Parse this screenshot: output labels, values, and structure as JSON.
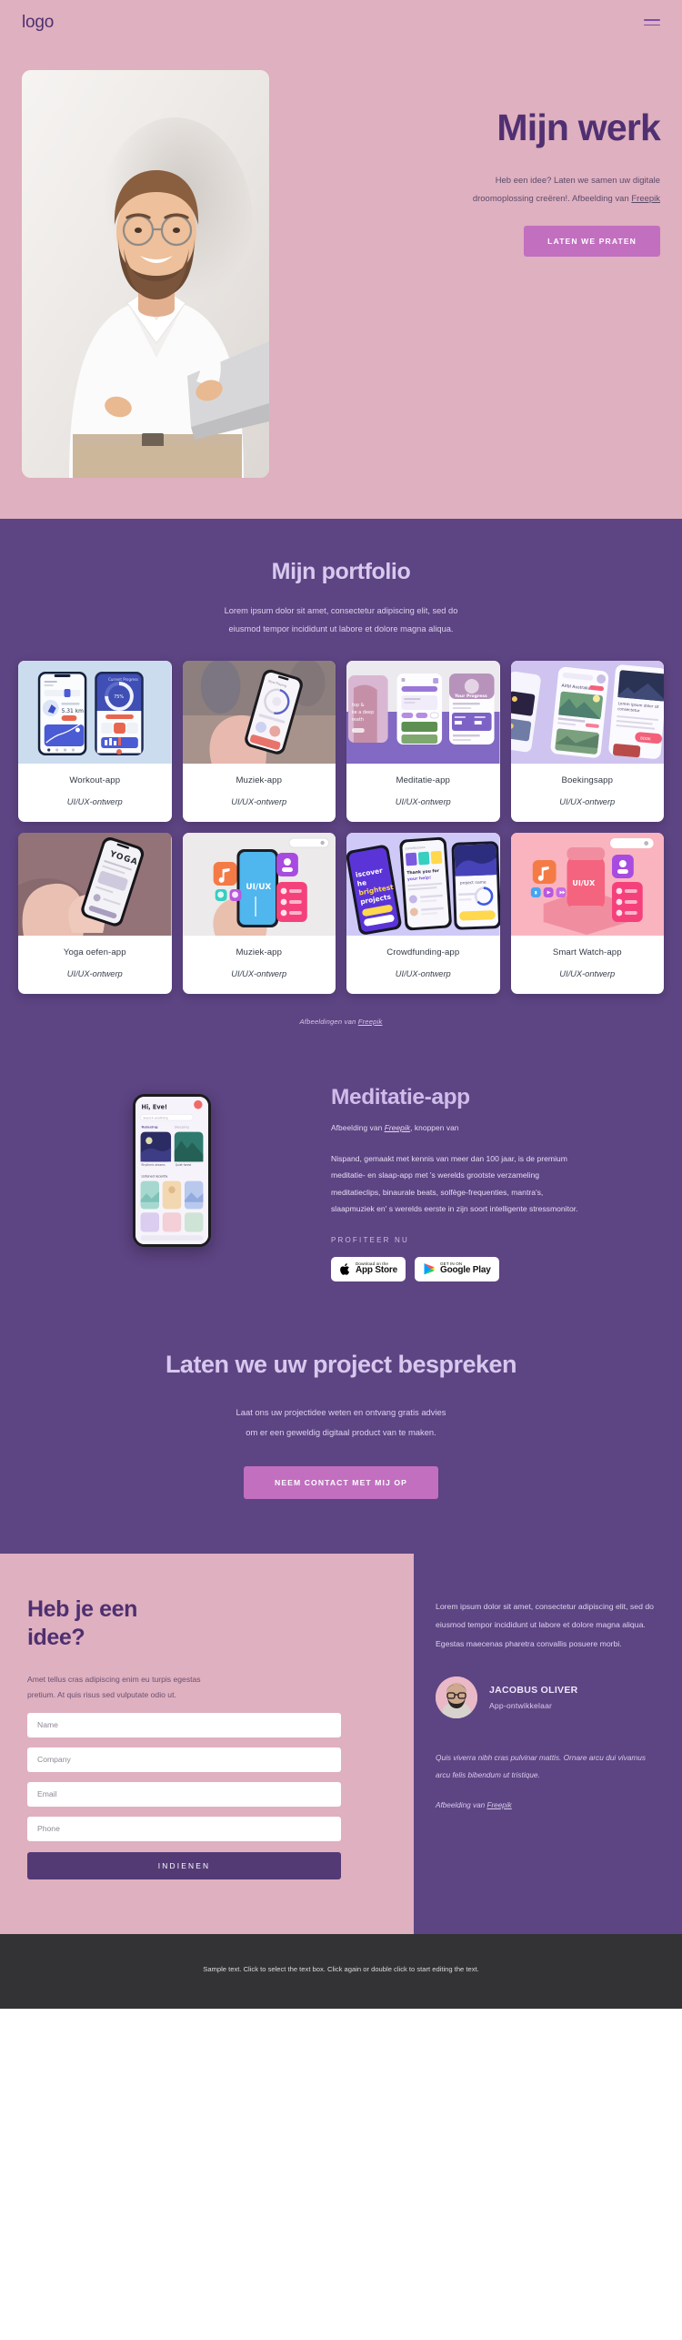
{
  "header": {
    "logo": "logo",
    "menu_icon": "hamburger-menu-icon"
  },
  "hero": {
    "title": "Mijn werk",
    "subtitle_line1": "Heb een idee? Laten we samen uw digitale",
    "subtitle_line2": "droomoplossing creëren!. Afbeelding van ",
    "subtitle_link": "Freepik",
    "cta_label": "LATEN WE PRATEN"
  },
  "portfolio": {
    "title": "Mijn portfolio",
    "subtitle_line1": "Lorem ipsum dolor sit amet, consectetur adipiscing elit, sed do",
    "subtitle_line2": "eiusmod tempor incididunt ut labore et dolore magna aliqua.",
    "cards": [
      {
        "title": "Workout-app",
        "subtitle": "UI/UX-ontwerp"
      },
      {
        "title": "Muziek-app",
        "subtitle": "UI/UX-ontwerp"
      },
      {
        "title": "Meditatie-app",
        "subtitle": "UI/UX-ontwerp"
      },
      {
        "title": "Boekingsapp",
        "subtitle": "UI/UX-ontwerp"
      },
      {
        "title": "Yoga oefen-app",
        "subtitle": "UI/UX-ontwerp"
      },
      {
        "title": "Muziek-app",
        "subtitle": "UI/UX-ontwerp"
      },
      {
        "title": "Crowdfunding-app",
        "subtitle": "UI/UX-ontwerp"
      },
      {
        "title": "Smart Watch-app",
        "subtitle": "UI/UX-ontwerp"
      }
    ],
    "credit_text": "Afbeeldingen van ",
    "credit_link": "Freepik"
  },
  "meditatie": {
    "title": "Meditatie-app",
    "credit_prefix": "Afbeelding van ",
    "credit_link": "Freepik",
    "credit_suffix": ", knoppen van",
    "body": "Nispand, gemaakt met kennis van meer dan 100 jaar, is de premium meditatie- en slaap-app met 's werelds grootste verzameling meditatieclips, binaurale beats, solfège-frequenties, mantra's, slaapmuziek en' s werelds eerste in zijn soort intelligente stressmonitor.",
    "label": "PROFITEER NU",
    "appstore_small": "Download on the",
    "appstore_big": "App Store",
    "googleplay_small": "GET IN ON",
    "googleplay_big": "Google Play",
    "phone_greeting": "Hi, Eve!"
  },
  "cta": {
    "title": "Laten we uw project bespreken",
    "sub_line1": "Laat ons uw projectidee weten en ontvang gratis advies",
    "sub_line2": "om er een geweldig digitaal product van te maken.",
    "button": "NEEM CONTACT MET MIJ OP"
  },
  "contact": {
    "title": "Heb je een idee?",
    "paragraph": "Amet tellus cras adipiscing enim eu turpis egestas pretium. At quis risus sed vulputate odio ut.",
    "fields": [
      {
        "name": "name",
        "placeholder": "Name",
        "value": ""
      },
      {
        "name": "company",
        "placeholder": "Company",
        "value": ""
      },
      {
        "name": "email",
        "placeholder": "Email",
        "value": ""
      },
      {
        "name": "phone",
        "placeholder": "Phone",
        "value": ""
      }
    ],
    "submit_label": "INDIENEN"
  },
  "testimonial": {
    "paragraph": "Lorem ipsum dolor sit amet, consectetur adipiscing elit, sed do eiusmod tempor incididunt ut labore et dolore magna aliqua. Egestas maecenas pharetra convallis posuere morbi.",
    "name": "JACOBUS OLIVER",
    "role": "App-ontwikkelaar",
    "quote": "Quis viverra nibh cras pulvinar mattis. Ornare arcu dui vivamus arcu felis bibendum ut tristique.",
    "credit_prefix": "Afbeelding van ",
    "credit_link": "Freepik"
  },
  "footer": {
    "text": "Sample text. Click to select the text box. Click again or double click to start editing the text."
  },
  "colors": {
    "pink_bg": "#dfb0bf",
    "purple_bg": "#5d4483",
    "purple_dark": "#4e3070",
    "accent_pink": "#c26fc0",
    "lavender": "#d8c8ee",
    "footer_bg": "#333336"
  }
}
